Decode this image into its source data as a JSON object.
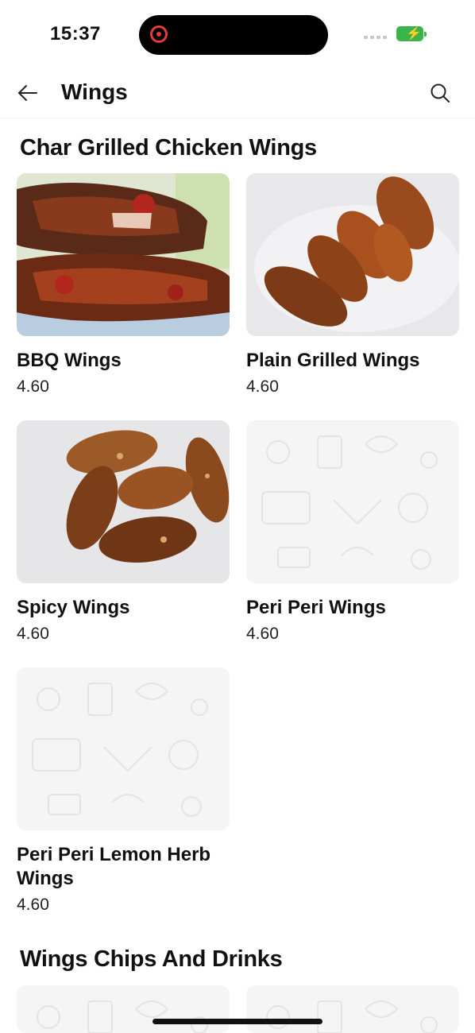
{
  "status_bar": {
    "time": "15:37"
  },
  "app_bar": {
    "title": "Wings"
  },
  "sections": [
    {
      "title": "Char Grilled Chicken Wings",
      "items": [
        {
          "name": "BBQ Wings",
          "price": "4.60",
          "image": "bbq-wings-photo"
        },
        {
          "name": "Plain Grilled Wings",
          "price": "4.60",
          "image": "plain-grilled-wings-photo"
        },
        {
          "name": "Spicy Wings",
          "price": "4.60",
          "image": "spicy-wings-photo"
        },
        {
          "name": "Peri Peri Wings",
          "price": "4.60",
          "image": "placeholder-pattern"
        },
        {
          "name": "Peri Peri Lemon Herb Wings",
          "price": "4.60",
          "image": "placeholder-pattern"
        }
      ]
    },
    {
      "title": "Wings Chips And Drinks",
      "items": []
    }
  ]
}
